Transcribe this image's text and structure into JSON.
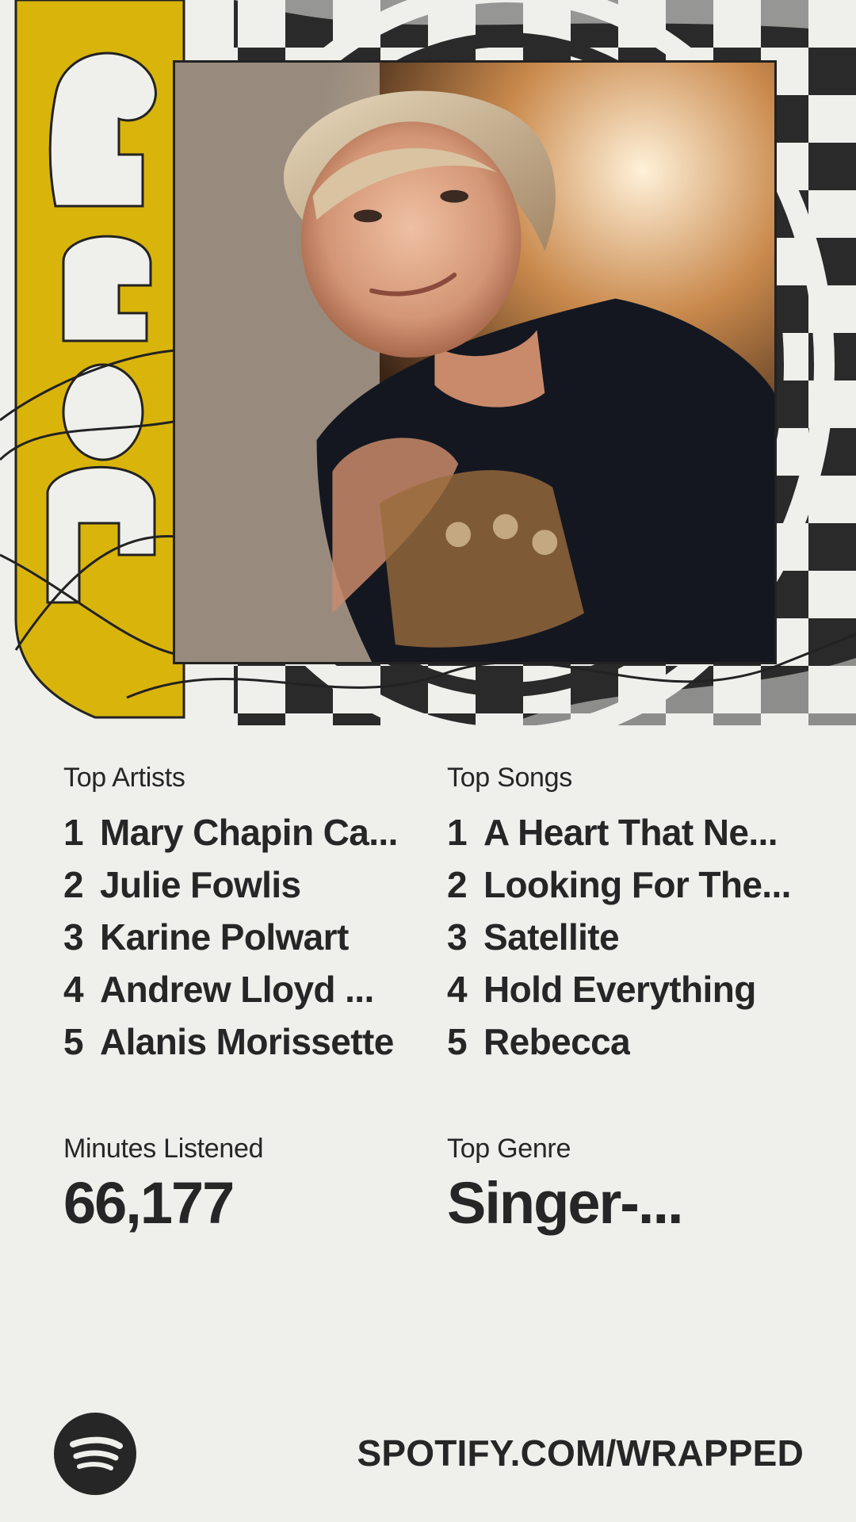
{
  "brand_colors": {
    "background": "#efefec",
    "ink": "#262626",
    "year_gold": "#d9b40b"
  },
  "hero": {
    "year_icon": "year-2025-graphic",
    "pattern_icon": "checkerboard-pattern",
    "photo_icon": "artist-photo"
  },
  "top_artists": {
    "label": "Top Artists",
    "items": [
      {
        "rank": "1",
        "name": "Mary Chapin Ca..."
      },
      {
        "rank": "2",
        "name": "Julie Fowlis"
      },
      {
        "rank": "3",
        "name": "Karine Polwart"
      },
      {
        "rank": "4",
        "name": "Andrew Lloyd ..."
      },
      {
        "rank": "5",
        "name": "Alanis Morissette"
      }
    ]
  },
  "top_songs": {
    "label": "Top Songs",
    "items": [
      {
        "rank": "1",
        "name": "A Heart That Ne..."
      },
      {
        "rank": "2",
        "name": "Looking For The..."
      },
      {
        "rank": "3",
        "name": "Satellite"
      },
      {
        "rank": "4",
        "name": "Hold Everything"
      },
      {
        "rank": "5",
        "name": "Rebecca"
      }
    ]
  },
  "minutes": {
    "label": "Minutes Listened",
    "value": "66,177"
  },
  "genre": {
    "label": "Top Genre",
    "value": "Singer-..."
  },
  "footer": {
    "logo_icon": "spotify-logo-icon",
    "url": "SPOTIFY.COM/WRAPPED"
  }
}
